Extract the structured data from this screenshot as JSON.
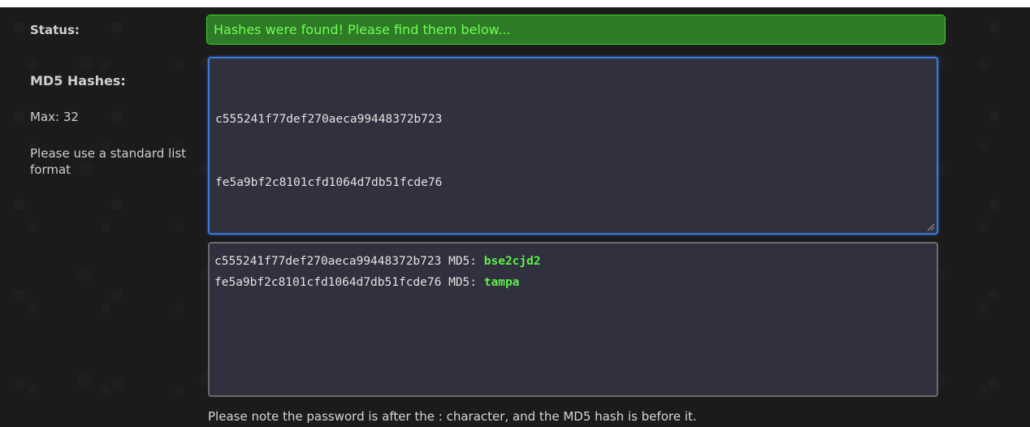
{
  "labels": {
    "status": "Status:",
    "md5_hashes": "MD5 Hashes:",
    "max": "Max: 32",
    "format_note": "Please use a standard list format"
  },
  "status": {
    "message": "Hashes were found! Please find them below..."
  },
  "input": {
    "hashes": [
      "c555241f77def270aeca99448372b723",
      "fe5a9bf2c8101cfd1064d7db51fcde76"
    ]
  },
  "results": [
    {
      "hash": "c555241f77def270aeca99448372b723",
      "type": "MD5:",
      "password": "bse2cjd2"
    },
    {
      "hash": "fe5a9bf2c8101cfd1064d7db51fcde76",
      "type": "MD5:",
      "password": "tampa"
    }
  ],
  "footer": {
    "note": "Please note the password is after the : character, and the MD5 hash is before it."
  },
  "colors": {
    "status_bg": "#2f7a26",
    "status_text": "#6dff53",
    "focus_border": "#3a7ad8",
    "password_text": "#5ef04a"
  }
}
